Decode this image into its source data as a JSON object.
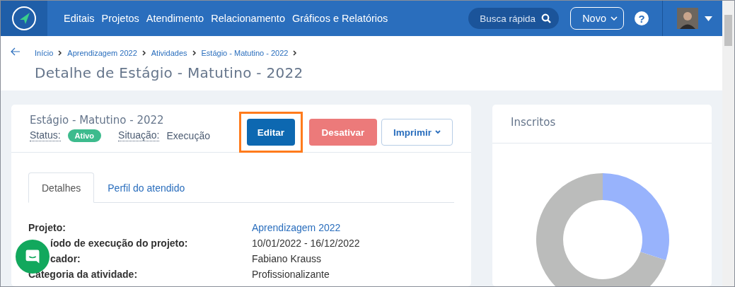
{
  "header": {
    "nav": [
      "Editais",
      "Projetos",
      "Atendimento",
      "Relacionamento",
      "Gráficos e Relatórios"
    ],
    "search": {
      "placeholder": "Busca rápida"
    },
    "new_button": "Novo",
    "help": "?"
  },
  "breadcrumb": [
    "Início",
    "Aprendizagem 2022",
    "Atividades",
    "Estágio - Matutino - 2022"
  ],
  "page_title": "Detalhe de Estágio - Matutino - 2022",
  "activity": {
    "name": "Estágio - Matutino - 2022",
    "status_label": "Status:",
    "status": "Ativo",
    "situation_label": "Situação:",
    "situation": "Execução",
    "buttons": [
      {
        "label": "Editar",
        "kind": "primary",
        "highlighted": true
      },
      {
        "label": "Desativar",
        "kind": "danger",
        "highlighted": false
      },
      {
        "label": "Imprimir",
        "kind": "dropdown",
        "highlighted": false
      }
    ],
    "tabs": [
      {
        "label": "Detalhes",
        "selected": true
      },
      {
        "label": "Perfil do atendido",
        "selected": false
      }
    ],
    "details": [
      {
        "label": "Projeto:",
        "value": "Aprendizagem 2022",
        "link": true,
        "covered": false
      },
      {
        "label": "íodo de execução do projeto:",
        "value": "10/01/2022 - 16/12/2022",
        "link": false,
        "covered": true
      },
      {
        "label": "cador:",
        "value": "Fabiano Krauss",
        "link": false,
        "covered": true
      },
      {
        "label": "Categoria da atividade:",
        "value": "Profissionalizante",
        "link": false,
        "covered": false
      }
    ]
  },
  "inscritos": {
    "title": "Inscritos"
  }
}
